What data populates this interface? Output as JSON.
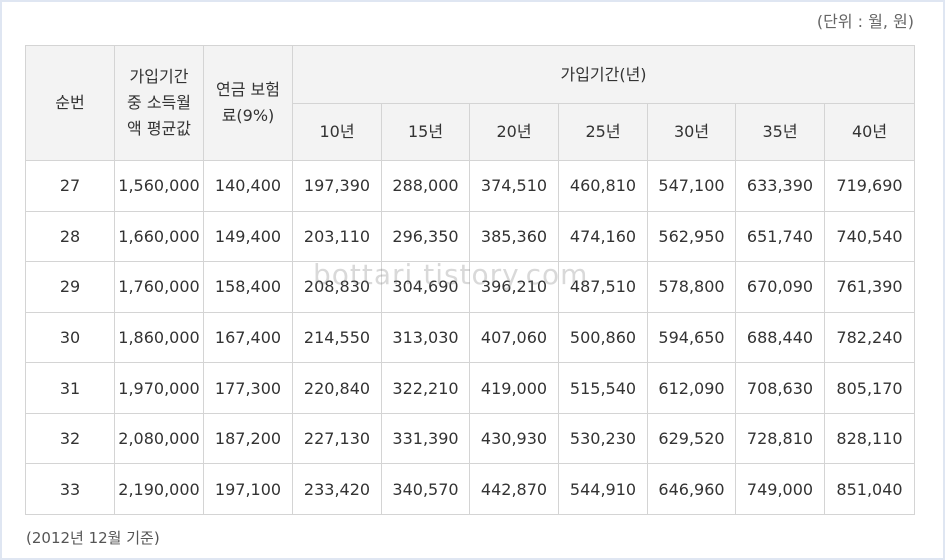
{
  "unit_note": "(단위 : 월, 원)",
  "footnote": "(2012년 12월 기준)",
  "watermark": "bottari.tistory.com",
  "table": {
    "header_no": "순번",
    "header_income": [
      "가입기간",
      "중 소득월",
      "액 평균값"
    ],
    "header_premium": [
      "연금 보험",
      "료(9%)"
    ],
    "header_period": "가입기간(년)",
    "periods": [
      "10년",
      "15년",
      "20년",
      "25년",
      "30년",
      "35년",
      "40년"
    ],
    "rows": [
      [
        "27",
        "1,560,000",
        "140,400",
        "197,390",
        "288,000",
        "374,510",
        "460,810",
        "547,100",
        "633,390",
        "719,690"
      ],
      [
        "28",
        "1,660,000",
        "149,400",
        "203,110",
        "296,350",
        "385,360",
        "474,160",
        "562,950",
        "651,740",
        "740,540"
      ],
      [
        "29",
        "1,760,000",
        "158,400",
        "208,830",
        "304,690",
        "396,210",
        "487,510",
        "578,800",
        "670,090",
        "761,390"
      ],
      [
        "30",
        "1,860,000",
        "167,400",
        "214,550",
        "313,030",
        "407,060",
        "500,860",
        "594,650",
        "688,440",
        "782,240"
      ],
      [
        "31",
        "1,970,000",
        "177,300",
        "220,840",
        "322,210",
        "419,000",
        "515,540",
        "612,090",
        "708,630",
        "805,170"
      ],
      [
        "32",
        "2,080,000",
        "187,200",
        "227,130",
        "331,390",
        "430,930",
        "530,230",
        "629,520",
        "728,810",
        "828,110"
      ],
      [
        "33",
        "2,190,000",
        "197,100",
        "233,420",
        "340,570",
        "442,870",
        "544,910",
        "646,960",
        "749,000",
        "851,040"
      ]
    ]
  }
}
